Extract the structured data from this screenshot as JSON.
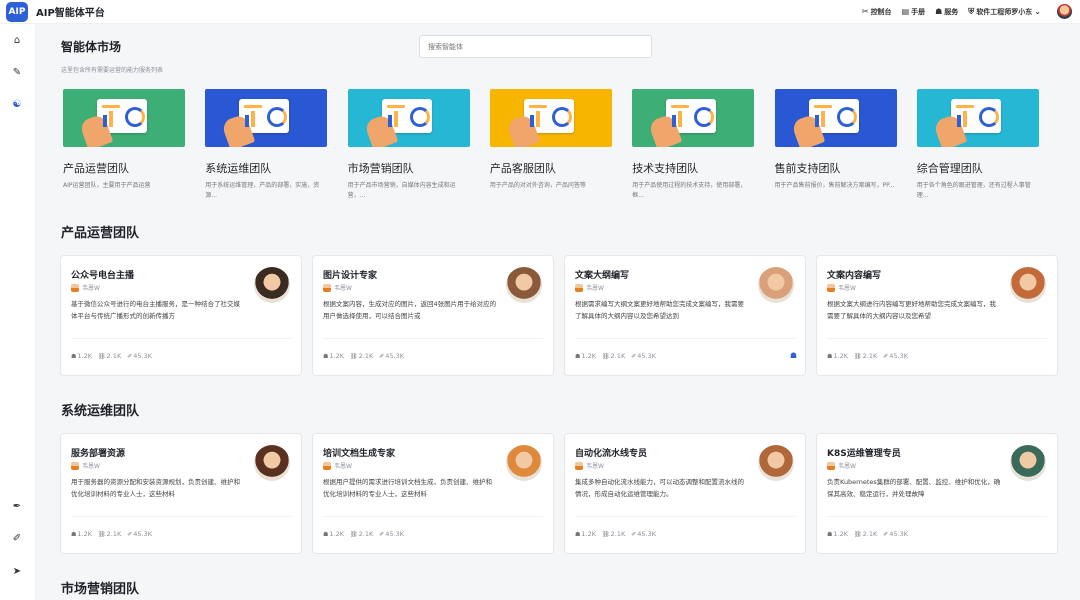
{
  "app": {
    "logo": "AIP",
    "title": "AIP智能体平台"
  },
  "topnav": [
    {
      "icon": "console-icon",
      "glyph": "✂",
      "label": "控制台"
    },
    {
      "icon": "manual-icon",
      "glyph": "▤",
      "label": "手册"
    },
    {
      "icon": "service-icon",
      "glyph": "☗",
      "label": "服务"
    },
    {
      "icon": "shield-icon",
      "glyph": "⛨",
      "label": "软件工程师罗小东"
    }
  ],
  "sidebar": [
    {
      "name": "home-icon",
      "glyph": "⌂",
      "active": false
    },
    {
      "name": "edit-icon",
      "glyph": "✎",
      "active": false
    },
    {
      "name": "agents-icon",
      "glyph": "☯",
      "active": true
    },
    {
      "name": "pen-icon",
      "glyph": "✒",
      "active": false
    },
    {
      "name": "brush-icon",
      "glyph": "✐",
      "active": false
    },
    {
      "name": "send-icon",
      "glyph": "➤",
      "active": false
    }
  ],
  "market": {
    "title": "智能体市场",
    "subtitle": "这里包含所有需要运营的能力服务列表",
    "search_placeholder": "搜索智能体"
  },
  "teams": [
    {
      "name": "产品运营团队",
      "desc": "AIP运营团队，主要用于产品运营",
      "color": "#3dae75"
    },
    {
      "name": "系统运维团队",
      "desc": "用于系统运维管理，产品的部署，实施，资源...",
      "color": "#2a57d3"
    },
    {
      "name": "市场营销团队",
      "desc": "用于产品市场营销，自媒体内容生成和运营，...",
      "color": "#25b7d3"
    },
    {
      "name": "产品客服团队",
      "desc": "用于产品的对对外咨询，产品问答等",
      "color": "#f7b500"
    },
    {
      "name": "技术支持团队",
      "desc": "用于产品使用过程的技术支持，使用部署，框...",
      "color": "#3dae75"
    },
    {
      "name": "售前支持团队",
      "desc": "用于产品售前报价，售前解决方案编写，PP...",
      "color": "#2a57d3"
    },
    {
      "name": "综合管理团队",
      "desc": "用于各个角色的跟进管理，还有过程人事管理...",
      "color": "#25b7d3"
    }
  ],
  "sections": [
    {
      "title": "产品运营团队",
      "agents": [
        {
          "name": "公众号电台主播",
          "author": "韦恩W",
          "desc": "基于微信公众号进行的电台主播服务，是一种结合了社交媒体平台与传统广播形式的创新传播方",
          "users": "1.2K",
          "links": "2.1K",
          "uses": "45.3K",
          "avatar": "#3a2a20"
        },
        {
          "name": "图片设计专家",
          "author": "韦恩W",
          "desc": "根据文案内容，生成对应的图片，返回4张图片用于给对应的用户做选择使用，可以结合图片或",
          "users": "1.2K",
          "links": "2.1K",
          "uses": "45.3K",
          "avatar": "#8a5a3a"
        },
        {
          "name": "文案大纲编写",
          "author": "韦恩W",
          "desc": "根据需求编写大纲文案更好地帮助您完成文案编写，我需要了解具体的大纲内容以及您希望达到",
          "users": "1.2K",
          "links": "2.1K",
          "uses": "45.3K",
          "avatar": "#d9a07a",
          "badge": true
        },
        {
          "name": "文案内容编写",
          "author": "韦恩W",
          "desc": "根据文案大纲进行内容编写更好地帮助您完成文案编写，我需要了解具体的大纲内容以及您希望",
          "users": "1.2K",
          "links": "2.1K",
          "uses": "45.3K",
          "avatar": "#c46a3a"
        }
      ]
    },
    {
      "title": "系统运维团队",
      "agents": [
        {
          "name": "服务部署资源",
          "author": "韦恩W",
          "desc": "用于服务器的资源分配和安装资源规划，负责创建、维护和优化培训材料的专业人士，这些材料",
          "users": "1.2K",
          "links": "2.1K",
          "uses": "45.3K",
          "avatar": "#5a3020"
        },
        {
          "name": "培训文档生成专家",
          "author": "韦恩W",
          "desc": "根据用户提供的需求进行培训文档生成，负责创建、维护和优化培训材料的专业人士，这些材料",
          "users": "1.2K",
          "links": "2.1K",
          "uses": "45.3K",
          "avatar": "#e0893a"
        },
        {
          "name": "自动化流水线专员",
          "author": "韦恩W",
          "desc": "集成多种自动化流水线能力，可以动态调整和配置流水线的情况，形成自动化运维管理能力。",
          "users": "1.2K",
          "links": "2.1K",
          "uses": "45.3K",
          "avatar": "#b0683a"
        },
        {
          "name": "K8S运维管理专员",
          "author": "韦恩W",
          "desc": "负责Kubernetes集群的部署、配置、监控、维护和优化，确保其高效、稳定运行，并处理故障",
          "users": "1.2K",
          "links": "2.1K",
          "uses": "45.3K",
          "avatar": "#3a6a5a"
        }
      ]
    },
    {
      "title": "市场营销团队",
      "agents": []
    }
  ]
}
